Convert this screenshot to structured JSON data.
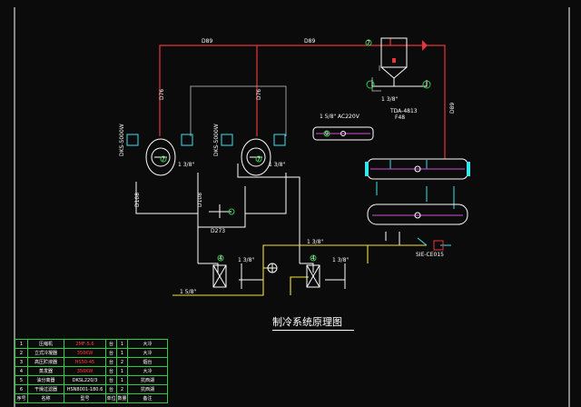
{
  "drawing": {
    "title": "制冷系统原理图",
    "pipe_labels": {
      "top_left": "D89",
      "top_right": "D89",
      "vert_1": "D76",
      "vert_2": "D76",
      "right_vert": "D89",
      "left_low": "D108",
      "right_low": "D108",
      "bottom_pipe": "D273",
      "liquid_1": "1 3/8\"",
      "liquid_2": "1 3/8\"",
      "liquid_3": "1 5/8\"",
      "liquid_4": "1 3/8\"",
      "small_1": "1 3/8\"",
      "small_2": "1 3/8\"",
      "small_3": "1 3/8\"",
      "ac220": "1 5/8\" AC220V",
      "tda": "TDA-4813",
      "f48": "F48",
      "compressor_1": "DKS-5000W",
      "compressor_2": "DKS-5000W",
      "vfd": "SIE-CE015",
      "circle_1": "7",
      "circle_2": "7",
      "circle_3": "7",
      "circle_4": "4",
      "circle_5": "4",
      "circle_6": "9"
    },
    "colors": {
      "red": "#e8343a",
      "white": "#ffffff",
      "green": "#2ecc40",
      "yellow": "#f2e335",
      "cyan": "#35e6f2",
      "magenta": "#d34fd3",
      "gray": "#9a9a9a"
    }
  },
  "parts_table": {
    "rows": [
      [
        "1",
        "压缩机",
        "2MF-5.6",
        "台",
        "1",
        "大冷"
      ],
      [
        "2",
        "立式冷凝器",
        "350KW",
        "台",
        "1",
        "大冷"
      ],
      [
        "3",
        "高压贮液器",
        "HS50-45",
        "台",
        "2",
        "烟台"
      ],
      [
        "4",
        "蒸发器",
        "350KW",
        "台",
        "1",
        "大冷"
      ],
      [
        "5",
        "油分离器",
        "DKSL220/3",
        "台",
        "1",
        "抗西湖"
      ],
      [
        "6",
        "干燥过滤器",
        "HSN8001-180.6",
        "台",
        "2",
        "抗西湖"
      ],
      [
        "序号",
        "名称",
        "型号",
        "单位",
        "数量",
        "备注"
      ]
    ]
  }
}
